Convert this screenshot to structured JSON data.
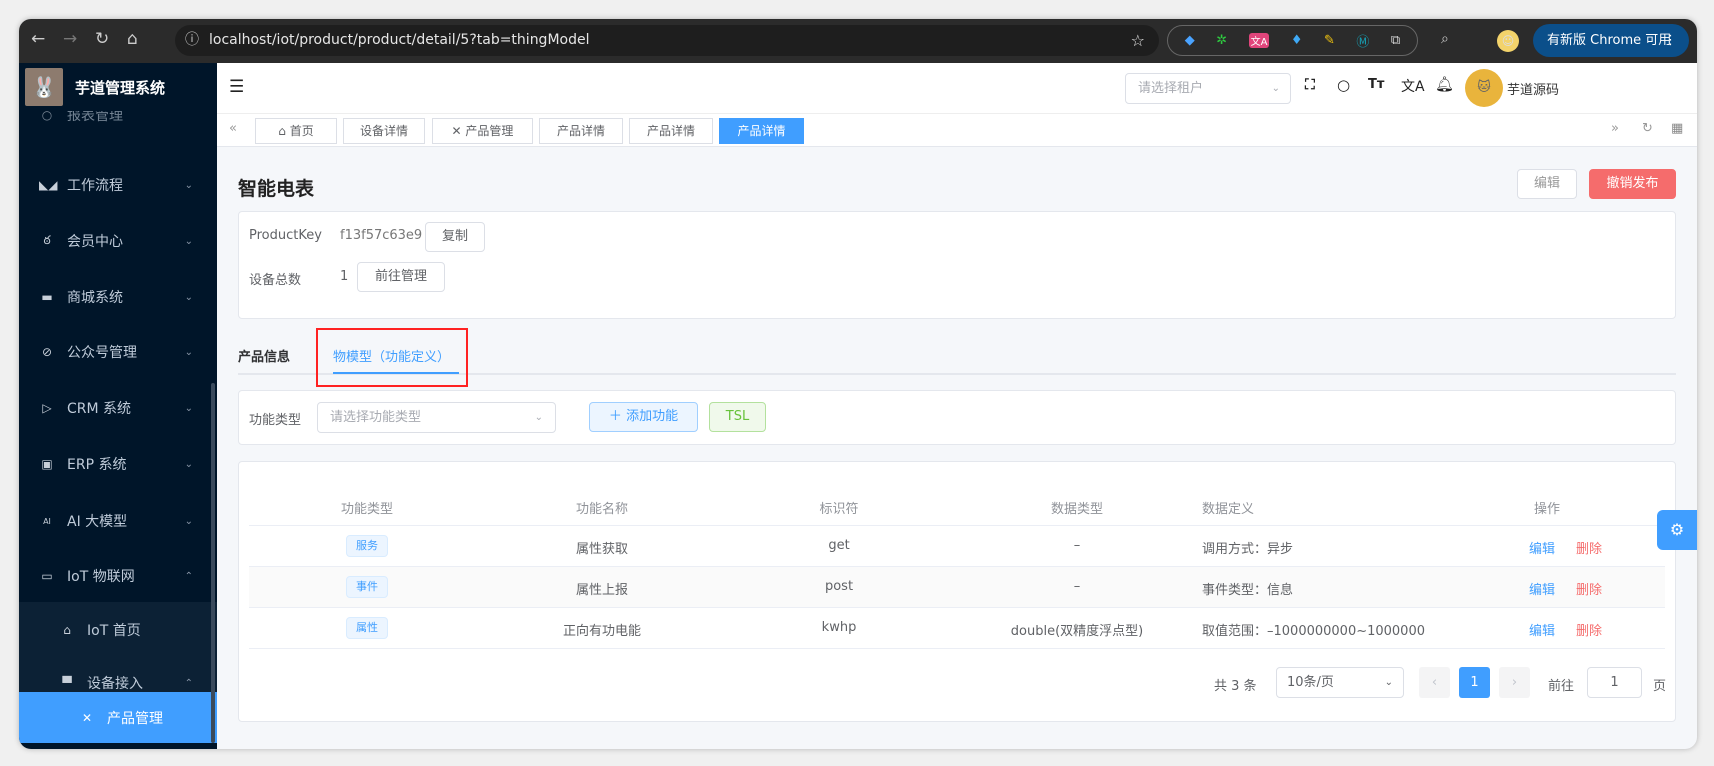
{
  "browser": {
    "url": "localhost/iot/product/product/detail/5?tab=thingModel",
    "update_label": "有新版 Chrome 可用"
  },
  "sidebar": {
    "app_title": "芋道管理系统",
    "partial_item": "报表管理",
    "items": [
      {
        "label": "工作流程",
        "icon": "workflow-icon"
      },
      {
        "label": "会员中心",
        "icon": "bike-icon"
      },
      {
        "label": "商城系统",
        "icon": "shop-icon"
      },
      {
        "label": "公众号管理",
        "icon": "compass-icon"
      },
      {
        "label": "CRM 系统",
        "icon": "crm-icon"
      },
      {
        "label": "ERP 系统",
        "icon": "erp-icon"
      },
      {
        "label": "AI 大模型",
        "icon": "ai-icon"
      },
      {
        "label": "IoT 物联网",
        "icon": "router-icon"
      }
    ],
    "sub_items": [
      {
        "label": "IoT 首页",
        "icon": "home-icon"
      },
      {
        "label": "设备接入",
        "icon": "monitor-icon"
      }
    ],
    "active_item": "产品管理"
  },
  "header": {
    "tenant_placeholder": "请选择租户",
    "username": "芋道源码"
  },
  "tags": [
    "首页",
    "设备详情",
    "产品管理",
    "产品详情",
    "产品详情",
    "产品详情"
  ],
  "product": {
    "title": "智能电表",
    "edit_label": "编辑",
    "unpublish_label": "撤销发布",
    "product_key_label": "ProductKey",
    "product_key": "f13f57c63e9",
    "copy_label": "复制",
    "device_count_label": "设备总数",
    "device_count": "1",
    "manage_label": "前往管理"
  },
  "tabs": [
    {
      "label": "产品信息"
    },
    {
      "label": "物模型（功能定义）",
      "active": true
    }
  ],
  "filter": {
    "type_label": "功能类型",
    "type_placeholder": "请选择功能类型",
    "add_label": "添加功能",
    "tsl_label": "TSL"
  },
  "table": {
    "headers": [
      "功能类型",
      "功能名称",
      "标识符",
      "数据类型",
      "数据定义",
      "操作"
    ],
    "rows": [
      {
        "type": "服务",
        "name": "属性获取",
        "identifier": "get",
        "data_type": "–",
        "definition": "调用方式：异步",
        "edit": "编辑",
        "delete": "删除"
      },
      {
        "type": "事件",
        "name": "属性上报",
        "identifier": "post",
        "data_type": "–",
        "definition": "事件类型：信息",
        "edit": "编辑",
        "delete": "删除"
      },
      {
        "type": "属性",
        "name": "正向有功电能",
        "identifier": "kwhp",
        "data_type": "double(双精度浮点型)",
        "definition": "取值范围：–1000000000~1000000",
        "edit": "编辑",
        "delete": "删除"
      }
    ]
  },
  "pagination": {
    "total": "共 3 条",
    "page_size": "10条/页",
    "current_page": "1",
    "goto_label": "前往",
    "goto_value": "1",
    "page_suffix": "页"
  }
}
